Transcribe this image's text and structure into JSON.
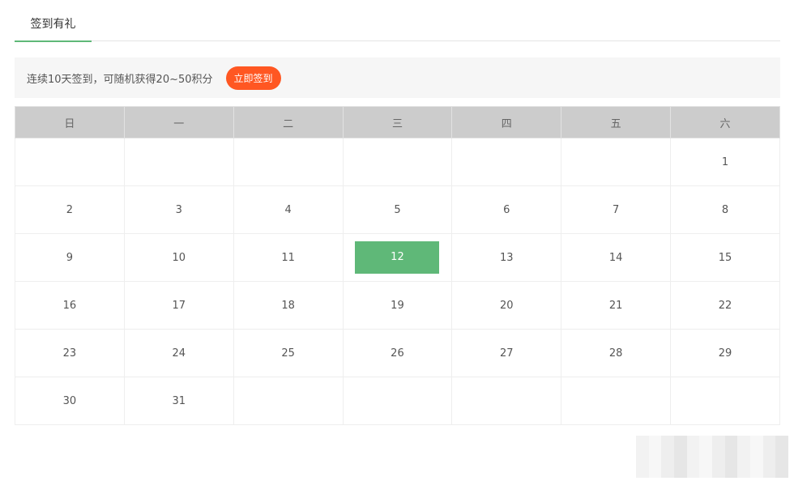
{
  "tabs": [
    {
      "label": "签到有礼"
    }
  ],
  "banner": {
    "text": "连续10天签到，可随机获得20~50积分",
    "button_label": "立即签到",
    "button_color": "#ff5722"
  },
  "calendar": {
    "weekdays": [
      "日",
      "一",
      "二",
      "三",
      "四",
      "五",
      "六"
    ],
    "weeks": [
      [
        "",
        "",
        "",
        "",
        "",
        "",
        "1"
      ],
      [
        "2",
        "3",
        "4",
        "5",
        "6",
        "7",
        "8"
      ],
      [
        "9",
        "10",
        "11",
        "12",
        "13",
        "14",
        "15"
      ],
      [
        "16",
        "17",
        "18",
        "19",
        "20",
        "21",
        "22"
      ],
      [
        "23",
        "24",
        "25",
        "26",
        "27",
        "28",
        "29"
      ],
      [
        "30",
        "31",
        "",
        "",
        "",
        "",
        ""
      ]
    ],
    "highlighted_day": "12",
    "highlight_color": "#5fb878",
    "header_color": "#cccccc"
  }
}
